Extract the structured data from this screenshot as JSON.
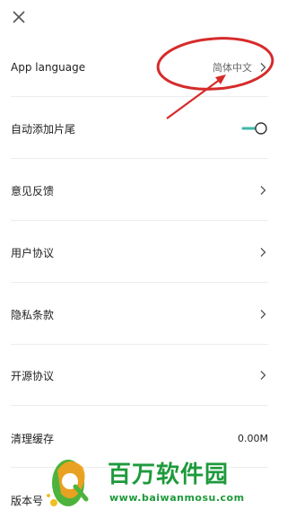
{
  "header": {
    "close_icon": "close-icon"
  },
  "settings": {
    "app_language": {
      "label": "App language",
      "value": "简体中文"
    },
    "auto_add_credits": {
      "label": "自动添加片尾",
      "toggle_on": true
    },
    "feedback": {
      "label": "意见反馈"
    },
    "user_agreement": {
      "label": "用户协议"
    },
    "privacy_policy": {
      "label": "隐私条款"
    },
    "open_source": {
      "label": "开源协议"
    },
    "clear_cache": {
      "label": "清理缓存",
      "value": "0.00M"
    },
    "version": {
      "label": "版本号"
    }
  },
  "watermark": {
    "title": "百万软件园",
    "url": "www.baiwanmosu.com"
  },
  "colors": {
    "accent": "#3fb9a8",
    "annotation": "#d62b2b",
    "watermark": "#1e9a3c"
  }
}
